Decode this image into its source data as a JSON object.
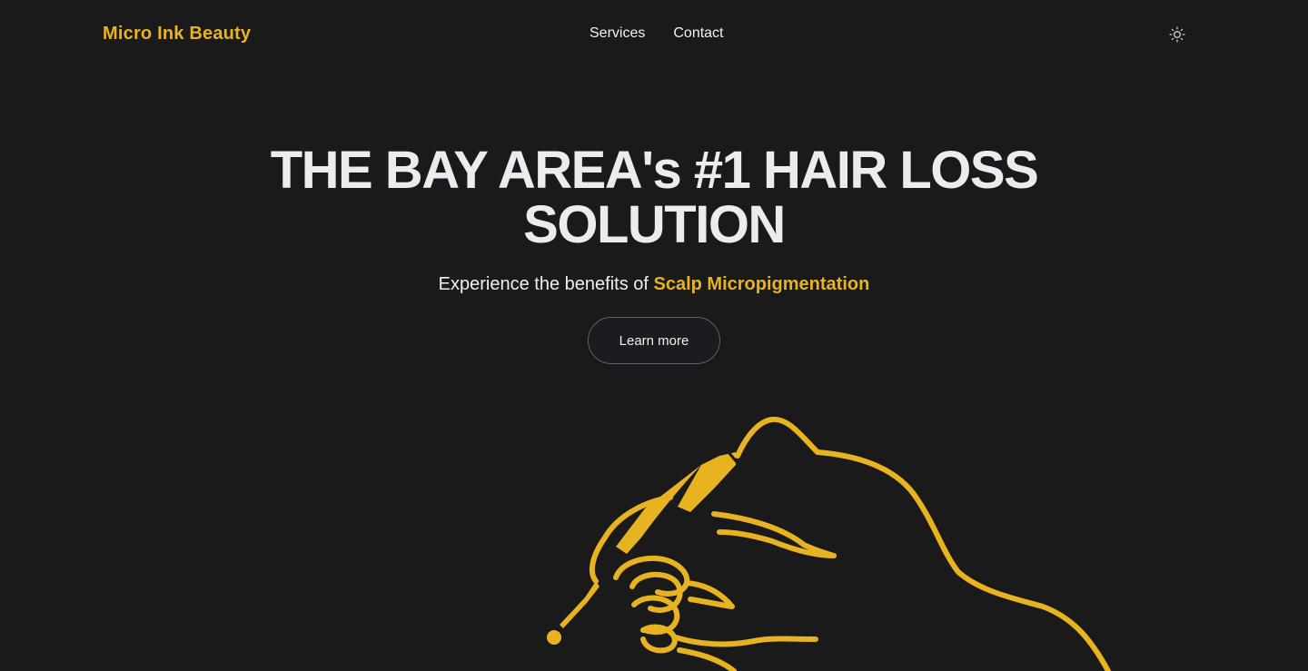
{
  "header": {
    "brand": "Micro Ink Beauty",
    "nav": [
      {
        "label": "Services"
      },
      {
        "label": "Contact"
      }
    ],
    "theme_toggle_icon": "sun-icon"
  },
  "hero": {
    "title": "THE BAY AREA's #1 HAIR LOSS SOLUTION",
    "subtitle_prefix": "Experience the benefits of",
    "subtitle_highlight": "Scalp Micropigmentation",
    "cta_label": "Learn more"
  },
  "illustration": {
    "icon": "hand-holding-tattoo-pen-icon"
  },
  "colors": {
    "background": "#1a1a1b",
    "accent": "#e8b320",
    "text": "#f0f0f0",
    "button_border": "#5b6068"
  }
}
